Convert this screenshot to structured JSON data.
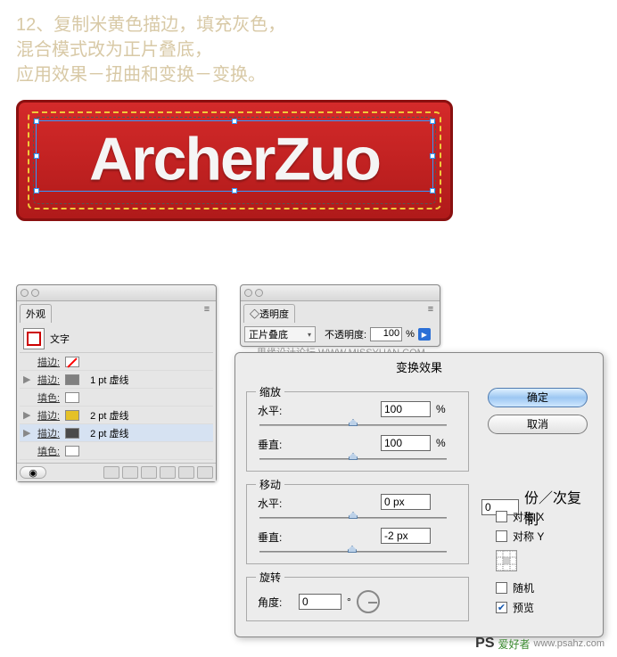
{
  "instructions": {
    "line1": "12、复制米黄色描边，填充灰色，",
    "line2": "混合模式改为正片叠底，",
    "line3": "应用效果－扭曲和变换－变换。"
  },
  "artwork": {
    "text": "ArcherZuo"
  },
  "appearance": {
    "tab": "外观",
    "object_type": "文字",
    "rows": [
      {
        "toggle": "",
        "swatch": "none",
        "label": "描边:",
        "value": ""
      },
      {
        "toggle": "▶",
        "swatch": "gray",
        "label": "描边:",
        "value": "1 pt 虚线"
      },
      {
        "toggle": "",
        "swatch": "white",
        "label": "填色:",
        "value": ""
      },
      {
        "toggle": "▶",
        "swatch": "yellow",
        "label": "描边:",
        "value": "2 pt 虚线"
      },
      {
        "toggle": "▶",
        "swatch": "dark",
        "label": "描边:",
        "value": "2 pt 虚线"
      },
      {
        "toggle": "",
        "swatch": "white",
        "label": "填色:",
        "value": ""
      }
    ],
    "selected_index": 4
  },
  "transparency": {
    "tab": "透明度",
    "mode": "正片叠底",
    "opacity_label": "不透明度:",
    "opacity_value": "100",
    "opacity_unit": "%"
  },
  "watermark": "思缘设计论坛  WWW.MISSYUAN.COM",
  "transform": {
    "title": "变换效果",
    "scale": {
      "label": "缩放",
      "h_label": "水平:",
      "h_value": "100",
      "h_unit": "%",
      "v_label": "垂直:",
      "v_value": "100",
      "v_unit": "%"
    },
    "move": {
      "label": "移动",
      "h_label": "水平:",
      "h_value": "0 px",
      "v_label": "垂直:",
      "v_value": "-2 px"
    },
    "rotate": {
      "label": "旋转",
      "angle_label": "角度:",
      "angle_value": "0",
      "angle_unit": "°"
    },
    "ok": "确定",
    "cancel": "取消",
    "copies_value": "0",
    "copies_label": "份／次复制",
    "mirror_x": "对称 X",
    "mirror_y": "对称 Y",
    "random": "随机",
    "preview": "预览",
    "preview_checked": true
  },
  "footer": {
    "ps": "PS",
    "name": "爱好者",
    "url": "www.psahz.com"
  }
}
